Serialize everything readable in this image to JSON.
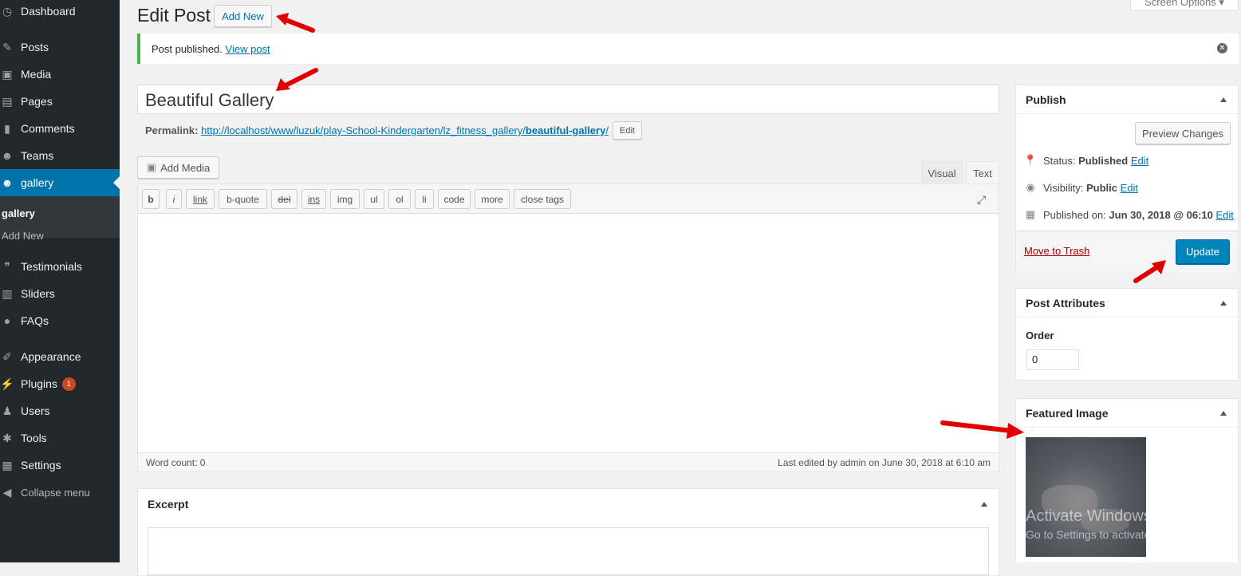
{
  "sidebar": {
    "items": [
      {
        "label": "Dashboard",
        "icon": "dashboard-icon",
        "glyph": "◷"
      },
      {
        "label": "Posts",
        "icon": "pin-icon",
        "glyph": "✎"
      },
      {
        "label": "Media",
        "icon": "media-icon",
        "glyph": "▣"
      },
      {
        "label": "Pages",
        "icon": "pages-icon",
        "glyph": "▤"
      },
      {
        "label": "Comments",
        "icon": "comment-icon",
        "glyph": "▮"
      },
      {
        "label": "Teams",
        "icon": "groups-icon",
        "glyph": "☻"
      },
      {
        "label": "gallery",
        "icon": "groups-icon",
        "glyph": "☻"
      },
      {
        "label": "Testimonials",
        "icon": "testimonial-icon",
        "glyph": "❞"
      },
      {
        "label": "Sliders",
        "icon": "slides-icon",
        "glyph": "▥"
      },
      {
        "label": "FAQs",
        "icon": "faq-icon",
        "glyph": "●"
      },
      {
        "label": "Appearance",
        "icon": "brush-icon",
        "glyph": "✐"
      },
      {
        "label": "Plugins",
        "icon": "plugin-icon",
        "glyph": "⚡",
        "badge": "1"
      },
      {
        "label": "Users",
        "icon": "users-icon",
        "glyph": "♟"
      },
      {
        "label": "Tools",
        "icon": "wrench-icon",
        "glyph": "✱"
      },
      {
        "label": "Settings",
        "icon": "settings-icon",
        "glyph": "▦"
      },
      {
        "label": "Collapse menu",
        "icon": "collapse-icon",
        "glyph": "◀"
      }
    ],
    "submenu": [
      "gallery",
      "Add New"
    ]
  },
  "header": {
    "title": "Edit Post",
    "add_new": "Add New",
    "screen_options": "Screen Options ▾"
  },
  "notice": {
    "text": "Post published.",
    "link": "View post"
  },
  "post": {
    "title": "Beautiful Gallery",
    "permalink_label": "Permalink:",
    "permalink_base": "http://localhost/www/luzuk/play-School-Kindergarten/lz_fitness_gallery/",
    "permalink_slug": "beautiful-gallery",
    "permalink_tail": "/",
    "permalink_edit": "Edit"
  },
  "editor": {
    "add_media": "Add Media",
    "tabs": [
      "Visual",
      "Text"
    ],
    "active_tab": "Text",
    "quicktags": [
      "b",
      "i",
      "link",
      "b-quote",
      "del",
      "ins",
      "img",
      "ul",
      "ol",
      "li",
      "code",
      "more",
      "close tags"
    ],
    "word_count": "Word count: 0",
    "last_edited": "Last edited by admin on June 30, 2018 at 6:10 am"
  },
  "excerpt": {
    "title": "Excerpt"
  },
  "publish": {
    "title": "Publish",
    "preview": "Preview Changes",
    "status_label": "Status:",
    "status_value": "Published",
    "visibility_label": "Visibility:",
    "visibility_value": "Public",
    "published_label": "Published on:",
    "published_value": "Jun 30, 2018 @ 06:10",
    "edit": "Edit",
    "trash": "Move to Trash",
    "update": "Update"
  },
  "attributes": {
    "title": "Post Attributes",
    "order_label": "Order",
    "order_value": "0"
  },
  "featured": {
    "title": "Featured Image"
  },
  "watermark": {
    "line1": "Activate Windows",
    "line2": "Go to Settings to activate Windows."
  },
  "colors": {
    "accent": "#0073aa",
    "primary_button": "#0085ba",
    "sidebar": "#23282d",
    "arrow": "#e00000"
  }
}
